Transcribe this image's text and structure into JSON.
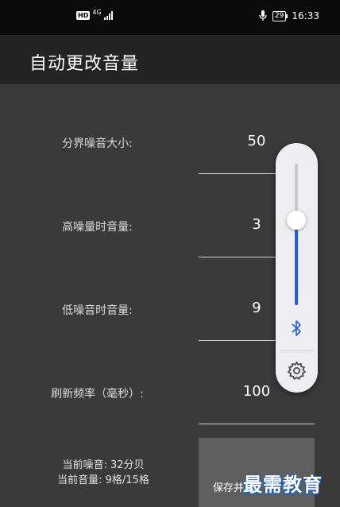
{
  "statusbar": {
    "hd_badge": "HD",
    "network": "4G",
    "battery": "29",
    "time": "16:33"
  },
  "app": {
    "title": "自动更改音量"
  },
  "settings": [
    {
      "label": "分界噪音大小:",
      "value": "50"
    },
    {
      "label": "高噪量时音量:",
      "value": "3"
    },
    {
      "label": "低噪音时音量:",
      "value": "9"
    },
    {
      "label": "刷新频率（毫秒）:",
      "value": "100"
    }
  ],
  "status": {
    "noise": "当前噪音: 32分贝",
    "volume": "当前音量: 9格/15格"
  },
  "save_button": {
    "label": "保存并..."
  },
  "watermark": {
    "text": "最需教育"
  },
  "volume_panel": {
    "level_fraction": 0.6,
    "accent_color": "#1f5fe0",
    "icons": [
      "bluetooth-icon",
      "gear-icon"
    ]
  },
  "colors": {
    "background": "#3a3a3a",
    "appbar": "#242424",
    "statusbar": "#0b0b0b",
    "accent": "#1f5fe0"
  }
}
